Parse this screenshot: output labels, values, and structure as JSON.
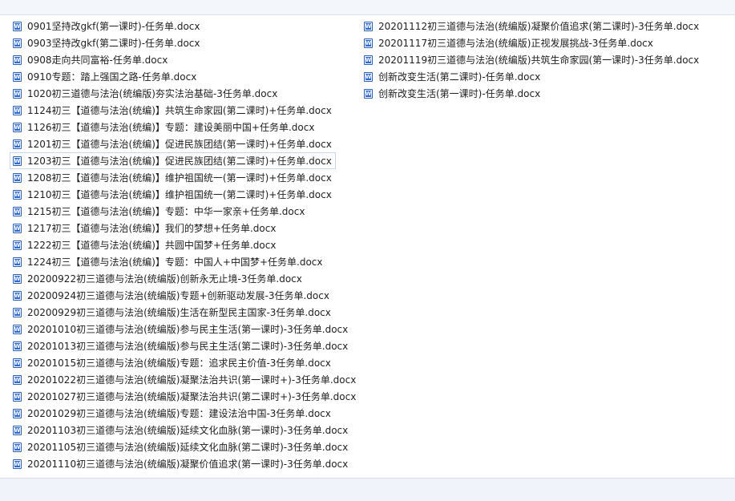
{
  "files": {
    "column_1": [
      {
        "name": "0901坚持改gkf(第一课时)-任务单.docx"
      },
      {
        "name": "0903坚持改gkf(第二课时)-任务单.docx"
      },
      {
        "name": "0908走向共同富裕-任务单.docx"
      },
      {
        "name": "0910专题：踏上强国之路-任务单.docx"
      },
      {
        "name": "1020初三道德与法治(统编版)夯实法治基础-3任务单.docx"
      },
      {
        "name": "1124初三【道德与法治(统编)】共筑生命家园(第二课时)+任务单.docx"
      },
      {
        "name": "1126初三【道德与法治(统编)】专题：建设美丽中国+任务单.docx"
      },
      {
        "name": "1201初三【道德与法治(统编)】促进民族团结(第一课时)+任务单.docx"
      },
      {
        "name": "1203初三【道德与法治(统编)】促进民族团结(第二课时)+任务单.docx",
        "selected": true
      },
      {
        "name": "1208初三【道德与法治(统编)】维护祖国统一(第一课时)+任务单.docx"
      },
      {
        "name": "1210初三【道德与法治(统编)】维护祖国统一(第二课时)+任务单.docx"
      },
      {
        "name": "1215初三【道德与法治(统编)】专题：中华一家亲+任务单.docx"
      },
      {
        "name": "1217初三【道德与法治(统编)】我们的梦想+任务单.docx"
      },
      {
        "name": "1222初三【道德与法治(统编)】共圆中国梦+任务单.docx"
      },
      {
        "name": "1224初三【道德与法治(统编)】专题：中国人+中国梦+任务单.docx"
      },
      {
        "name": "20200922初三道德与法治(统编版)创新永无止境-3任务单.docx"
      },
      {
        "name": "20200924初三道德与法治(统编版)专题+创新驱动发展-3任务单.docx"
      },
      {
        "name": "20200929初三道德与法治(统编版)生活在新型民主国家-3任务单.docx"
      },
      {
        "name": "20201010初三道德与法治(统编版)参与民主生活(第一课时)-3任务单.docx"
      },
      {
        "name": "20201013初三道德与法治(统编版)参与民主生活(第二课时)-3任务单.docx"
      },
      {
        "name": "20201015初三道德与法治(统编版)专题：追求民主价值-3任务单.docx"
      },
      {
        "name": "20201022初三道德与法治(统编版)凝聚法治共识(第一课时+)-3任务单.docx"
      },
      {
        "name": "20201027初三道德与法治(统编版)凝聚法治共识(第二课时+)-3任务单.docx"
      },
      {
        "name": "20201029初三道德与法治(统编版)专题：建设法治中国-3任务单.docx"
      },
      {
        "name": "20201103初三道德与法治(统编版)延续文化血脉(第一课时)-3任务单.docx"
      },
      {
        "name": "20201105初三道德与法治(统编版)延续文化血脉(第二课时)-3任务单.docx"
      },
      {
        "name": "20201110初三道德与法治(统编版)凝聚价值追求(第一课时)-3任务单.docx"
      }
    ],
    "column_2": [
      {
        "name": "20201112初三道德与法治(统编版)凝聚价值追求(第二课时)-3任务单.docx"
      },
      {
        "name": "20201117初三道德与法治(统编版)正视发展挑战-3任务单.docx"
      },
      {
        "name": "20201119初三道德与法治(统编版)共筑生命家园(第一课时)-3任务单.docx"
      },
      {
        "name": "创新改变生活(第二课时)-任务单.docx"
      },
      {
        "name": "创新改变生活(第一课时)-任务单.docx"
      }
    ]
  },
  "icons": {
    "file_icon": "word-document-icon",
    "icon_color": "#2f6ad0"
  }
}
